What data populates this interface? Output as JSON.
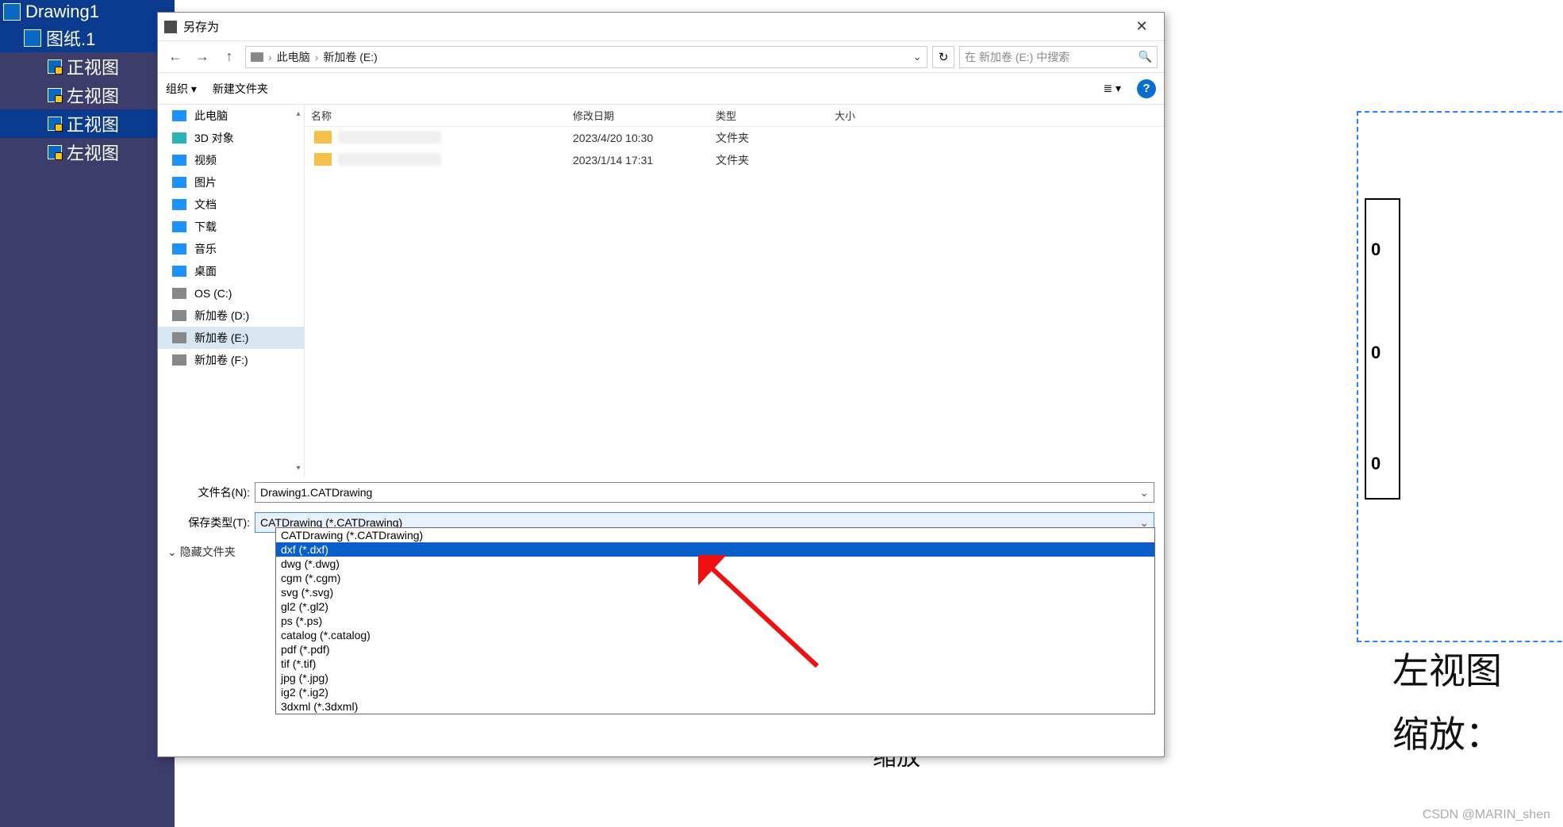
{
  "tree": {
    "root": "Drawing1",
    "sheet": "图纸.1",
    "views": [
      "正视图",
      "左视图",
      "正视图",
      "左视图"
    ]
  },
  "dialog": {
    "title": "另存为",
    "close": "✕",
    "nav": {
      "back": "←",
      "forward": "→",
      "up": "↑",
      "refresh": "↻"
    },
    "crumb": {
      "pc": "此电脑",
      "drive": "新加卷 (E:)"
    },
    "search_placeholder": "在 新加卷 (E:) 中搜索",
    "tools": {
      "organize": "组织",
      "newfolder": "新建文件夹",
      "view": "≣",
      "help": "?"
    },
    "sidebar": [
      {
        "label": "此电脑",
        "icon": "ic-pc"
      },
      {
        "label": "3D 对象",
        "icon": "ic-3d"
      },
      {
        "label": "视频",
        "icon": "ic-vid"
      },
      {
        "label": "图片",
        "icon": "ic-img"
      },
      {
        "label": "文档",
        "icon": "ic-doc"
      },
      {
        "label": "下载",
        "icon": "ic-dl"
      },
      {
        "label": "音乐",
        "icon": "ic-mus"
      },
      {
        "label": "桌面",
        "icon": "ic-dsk"
      },
      {
        "label": "OS (C:)",
        "icon": "ic-drv"
      },
      {
        "label": "新加卷 (D:)",
        "icon": "ic-drv"
      },
      {
        "label": "新加卷 (E:)",
        "icon": "ic-drv",
        "selected": true
      },
      {
        "label": "新加卷 (F:)",
        "icon": "ic-drv"
      }
    ],
    "cols": {
      "name": "名称",
      "date": "修改日期",
      "type": "类型",
      "size": "大小"
    },
    "files": [
      {
        "date": "2023/4/20 10:30",
        "type": "文件夹"
      },
      {
        "date": "2023/1/14 17:31",
        "type": "文件夹"
      }
    ],
    "filename_label": "文件名(N):",
    "filename_value": "Drawing1.CATDrawing",
    "filetype_label": "保存类型(T):",
    "filetype_value": "CATDrawing (*.CATDrawing)",
    "hide_folders": "隐藏文件夹",
    "type_options": [
      "CATDrawing (*.CATDrawing)",
      "dxf (*.dxf)",
      "dwg (*.dwg)",
      "cgm (*.cgm)",
      "svg (*.svg)",
      "gl2 (*.gl2)",
      "ps (*.ps)",
      "catalog (*.catalog)",
      "pdf (*.pdf)",
      "tif (*.tif)",
      "jpg (*.jpg)",
      "ig2 (*.ig2)",
      "3dxml (*.3dxml)"
    ],
    "highlight_index": 1
  },
  "canvas": {
    "label1": "左视图",
    "label2": "缩放：",
    "label3": "缩放",
    "glyph": "0"
  },
  "watermark": "CSDN @MARIN_shen"
}
